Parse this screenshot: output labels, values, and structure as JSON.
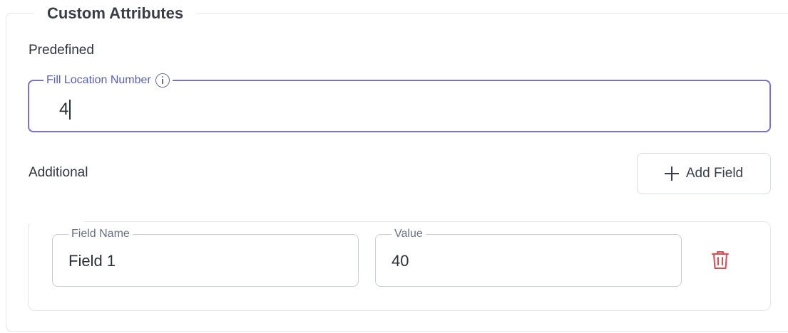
{
  "section": {
    "title": "Custom Attributes",
    "predefined_label": "Predefined",
    "additional_label": "Additional"
  },
  "fill_location": {
    "label": "Fill Location Number",
    "value": "4",
    "info_icon": "info-circle-icon"
  },
  "add_field_button": {
    "label": "Add Field",
    "icon": "plus-icon"
  },
  "additional_fields": [
    {
      "name_label": "Field Name",
      "name_value": "Field 1",
      "value_label": "Value",
      "value_value": "40",
      "delete_icon": "trash-icon"
    }
  ],
  "colors": {
    "focus_border": "#7c6fd1",
    "delete": "#e5484d"
  }
}
